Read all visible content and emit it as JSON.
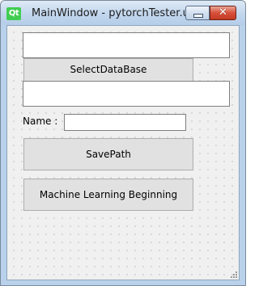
{
  "window": {
    "title": "MainWindow - pytorchTester.ui",
    "app_icon_text": "Qt",
    "close_glyph": "✕",
    "icons": {
      "app": "qt-logo-icon",
      "minimize": "minimize-icon",
      "close": "close-icon",
      "resize": "size-grip-icon"
    },
    "colors": {
      "qt_green": "#41cd52",
      "close_red": "#d7503a",
      "frame_blue": "#b9d1ea"
    }
  },
  "form": {
    "database_path": {
      "value": ""
    },
    "select_database_button": {
      "label": "SelectDataBase"
    },
    "save_path": {
      "value": ""
    },
    "name_label": "Name :",
    "name_field": {
      "value": ""
    },
    "save_path_button": {
      "label": "SavePath"
    },
    "ml_begin_button": {
      "label": "Machine Learning Beginning"
    }
  }
}
